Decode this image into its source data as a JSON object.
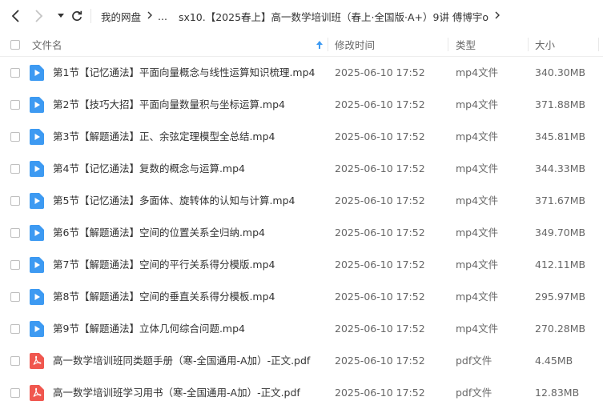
{
  "nav": {
    "back_icon": "chevron-left-icon",
    "forward_icon": "chevron-right-icon",
    "dropdown_icon": "caret-down-icon",
    "refresh_icon": "refresh-icon"
  },
  "breadcrumb": {
    "root": "我的网盘",
    "ellipsis": "...",
    "current": "sx10.【2025春上】高一数学培训班（春上·全国版·A+）9讲 傅博宇o"
  },
  "columns": {
    "name": "文件名",
    "modified": "修改时间",
    "type": "类型",
    "size": "大小"
  },
  "colors": {
    "video_icon": "#3d9af2",
    "pdf_icon": "#f0574f",
    "sort_arrow": "#3d9af2"
  },
  "files": [
    {
      "name": "第1节【记忆通法】平面向量概念与线性运算知识梳理.mp4",
      "modified": "2025-06-10 17:52",
      "type": "mp4文件",
      "size": "340.30MB",
      "icon": "video-file-icon"
    },
    {
      "name": "第2节【技巧大招】平面向量数量积与坐标运算.mp4",
      "modified": "2025-06-10 17:52",
      "type": "mp4文件",
      "size": "371.88MB",
      "icon": "video-file-icon"
    },
    {
      "name": "第3节【解题通法】正、余弦定理模型全总结.mp4",
      "modified": "2025-06-10 17:52",
      "type": "mp4文件",
      "size": "345.81MB",
      "icon": "video-file-icon"
    },
    {
      "name": "第4节【记忆通法】复数的概念与运算.mp4",
      "modified": "2025-06-10 17:52",
      "type": "mp4文件",
      "size": "344.33MB",
      "icon": "video-file-icon"
    },
    {
      "name": "第5节【记忆通法】多面体、旋转体的认知与计算.mp4",
      "modified": "2025-06-10 17:52",
      "type": "mp4文件",
      "size": "371.67MB",
      "icon": "video-file-icon"
    },
    {
      "name": "第6节【解题通法】空间的位置关系全归纳.mp4",
      "modified": "2025-06-10 17:52",
      "type": "mp4文件",
      "size": "349.70MB",
      "icon": "video-file-icon"
    },
    {
      "name": "第7节【解题通法】空间的平行关系得分模版.mp4",
      "modified": "2025-06-10 17:52",
      "type": "mp4文件",
      "size": "412.11MB",
      "icon": "video-file-icon"
    },
    {
      "name": "第8节【解题通法】空间的垂直关系得分模板.mp4",
      "modified": "2025-06-10 17:52",
      "type": "mp4文件",
      "size": "295.97MB",
      "icon": "video-file-icon"
    },
    {
      "name": "第9节【解题通法】立体几何综合问题.mp4",
      "modified": "2025-06-10 17:52",
      "type": "mp4文件",
      "size": "270.28MB",
      "icon": "video-file-icon"
    },
    {
      "name": "高一数学培训班同类题手册（寒-全国通用-A加）-正文.pdf",
      "modified": "2025-06-10 17:52",
      "type": "pdf文件",
      "size": "4.45MB",
      "icon": "pdf-file-icon"
    },
    {
      "name": "高一数学培训班学习用书（寒-全国通用-A加）-正文.pdf",
      "modified": "2025-06-10 17:52",
      "type": "pdf文件",
      "size": "12.83MB",
      "icon": "pdf-file-icon"
    }
  ]
}
